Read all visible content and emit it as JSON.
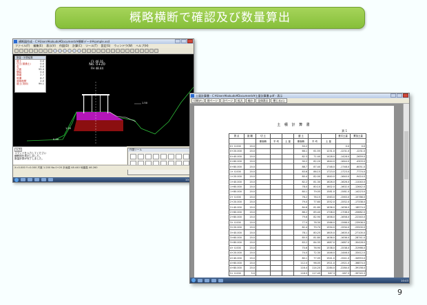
{
  "slide": {
    "title": "概略横断で確認及び数量算出",
    "page_number": "9"
  },
  "cad_window": {
    "title": "横断図作成 - C:¥Users¥kokudo¥Documents¥横断データ¥sample.xsd",
    "menu": [
      "ファイル(F)",
      "編集(E)",
      "表示(V)",
      "作図(D)",
      "計算(C)",
      "ツール(T)",
      "設定(S)",
      "ウィンドウ(W)",
      "ヘルプ(H)"
    ],
    "info_panel_title": "数量 : 計算結果",
    "info_rows": [
      {
        "k": "盛土",
        "v": "0.0"
      },
      {
        "k": "切土(普通土)",
        "v": "0.0"
      },
      {
        "k": "岩",
        "v": "0.0"
      },
      {
        "k": "法面",
        "v": "55.4"
      },
      {
        "k": "舗装",
        "v": "0.0"
      },
      {
        "k": "路盤",
        "v": "2.7"
      },
      {
        "k": "側溝",
        "v": "6.7"
      },
      {
        "k": "道路面積",
        "v": "2.0"
      },
      {
        "k": "盛土(流用)",
        "v": "99.1"
      }
    ],
    "section_label": "No. 0+20",
    "section_sub_1": "CL 46.26",
    "section_sub_2": "FH 48.44",
    "label_left": "1.20",
    "label_right": "1.50",
    "label_bottom": "0.00",
    "cmd_tag": "入力",
    "cmd_lines": [
      "コマンドを入力してください",
      "横断図を表示しました。",
      "数量計算が完了しました。"
    ],
    "palette_title": "作図ツール",
    "status": "X=0.000  Y=0.000  尺度 1:200  No.0+20  計画高 48.440  地盤高 46.260",
    "clock": "10:35"
  },
  "doc_window": {
    "title": "土量計算書 - C:¥Users¥kokudo¥Documents¥土量計算書.pdf - 表示",
    "toolbar": [
      "印刷(P)",
      "前ページ",
      "次ページ",
      "拡大",
      "縮小",
      "全体表示",
      "閉じる(C)"
    ],
    "heading": "土 積 計 算 書",
    "unit": "頁 1",
    "col_head_1": [
      "測 点",
      "距 離",
      "切 土",
      "",
      "",
      "盛 土",
      "",
      "",
      "差引土量",
      "累加土量"
    ],
    "col_head_2": [
      "",
      "",
      "断面積",
      "平 均",
      "土 量",
      "断面積",
      "平 均",
      "土 量",
      "",
      ""
    ],
    "rows": [
      [
        "0+ 0.000",
        "20.0",
        "",
        "",
        "",
        "50.2",
        "",
        "",
        "0.0",
        "0.0"
      ],
      [
        "0+20.000",
        "20.0",
        "",
        "",
        "",
        "66.1",
        "61.55",
        "1231.0",
        "-1231.0",
        "-1231.0"
      ],
      [
        "0+40.000",
        "20.0",
        "",
        "",
        "",
        "82.3",
        "71.40",
        "1428.0",
        "-1428.0",
        "-2659.0"
      ],
      [
        "0+60.000",
        "20.0",
        "",
        "",
        "",
        "90.2",
        "82.20",
        "1644.0",
        "-1644.0",
        "-4303.0"
      ],
      [
        "0+80.000",
        "20.0",
        "",
        "",
        "",
        "88.7",
        "87.40",
        "1748.0",
        "-1748.0",
        "-6051.0"
      ],
      [
        "1+ 0.000",
        "20.0",
        "",
        "",
        "",
        "83.6",
        "86.15",
        "1723.0",
        "-1723.0",
        "-7774.0"
      ],
      [
        "1+20.000",
        "20.0",
        "",
        "",
        "",
        "80.4",
        "82.00",
        "1640.0",
        "-1640.0",
        "-9414.0"
      ],
      [
        "1+40.000",
        "20.0",
        "",
        "",
        "",
        "82.2",
        "81.30",
        "1626.0",
        "-1626.0",
        "-11040.0"
      ],
      [
        "1+60.000",
        "20.0",
        "",
        "",
        "",
        "78.0",
        "80.10",
        "1602.0",
        "-1602.0",
        "-12642.0"
      ],
      [
        "1+80.000",
        "20.0",
        "",
        "",
        "",
        "80.1",
        "79.05",
        "1581.0",
        "-1581.0",
        "-14223.0"
      ],
      [
        "2+ 0.000",
        "20.0",
        "",
        "",
        "",
        "76.2",
        "78.15",
        "1563.0",
        "-1563.0",
        "-15786.0"
      ],
      [
        "2+20.000",
        "20.0",
        "",
        "",
        "",
        "79.0",
        "77.60",
        "1552.0",
        "-1552.0",
        "-17338.0"
      ],
      [
        "2+40.000",
        "20.0",
        "",
        "",
        "",
        "84.6",
        "81.80",
        "1636.0",
        "-1636.0",
        "-18974.0"
      ],
      [
        "2+60.000",
        "20.0",
        "",
        "",
        "",
        "86.2",
        "85.40",
        "1708.0",
        "-1708.0",
        "-20682.0"
      ],
      [
        "2+80.000",
        "20.0",
        "",
        "",
        "",
        "79.6",
        "82.90",
        "1658.0",
        "-1658.0",
        "-22340.0"
      ],
      [
        "3+ 0.000",
        "20.0",
        "",
        "",
        "",
        "77.0",
        "78.30",
        "1566.0",
        "-1566.0",
        "-23906.0"
      ],
      [
        "3+20.000",
        "20.0",
        "",
        "",
        "",
        "82.4",
        "79.70",
        "1594.0",
        "-1594.0",
        "-25500.0"
      ],
      [
        "3+40.000",
        "20.0",
        "",
        "",
        "",
        "78.1",
        "80.25",
        "1605.0",
        "-1605.0",
        "-27105.0"
      ],
      [
        "3+60.000",
        "20.0",
        "",
        "",
        "",
        "85.5",
        "81.80",
        "1636.0",
        "-1636.0",
        "-28741.0"
      ],
      [
        "3+80.000",
        "20.0",
        "",
        "",
        "",
        "83.2",
        "84.35",
        "1687.0",
        "-1687.0",
        "-30428.0"
      ],
      [
        "4+ 0.000",
        "20.0",
        "",
        "",
        "",
        "70.6",
        "76.90",
        "1538.0",
        "-1538.0",
        "-31966.0"
      ],
      [
        "4+20.000",
        "20.0",
        "",
        "",
        "",
        "74.0",
        "72.30",
        "1446.0",
        "-1446.0",
        "-33412.0"
      ],
      [
        "4+40.000",
        "20.0",
        "",
        "",
        "",
        "80.1",
        "77.05",
        "1541.0",
        "-1541.0",
        "-34953.0"
      ],
      [
        "4+60.000",
        "20.0",
        "",
        "",
        "",
        "112.0",
        "96.05",
        "1921.0",
        "-1921.0",
        "-36874.0"
      ],
      [
        "4+80.000",
        "20.0",
        "",
        "",
        "",
        "116.4",
        "114.20",
        "2284.0",
        "-2284.0",
        "-39158.0"
      ],
      [
        "5+ 0.000",
        "5.0",
        "",
        "",
        "",
        "118.5",
        "117.45",
        "587.3",
        "-587.3",
        "-39745.3"
      ]
    ],
    "clock": "10:43"
  }
}
